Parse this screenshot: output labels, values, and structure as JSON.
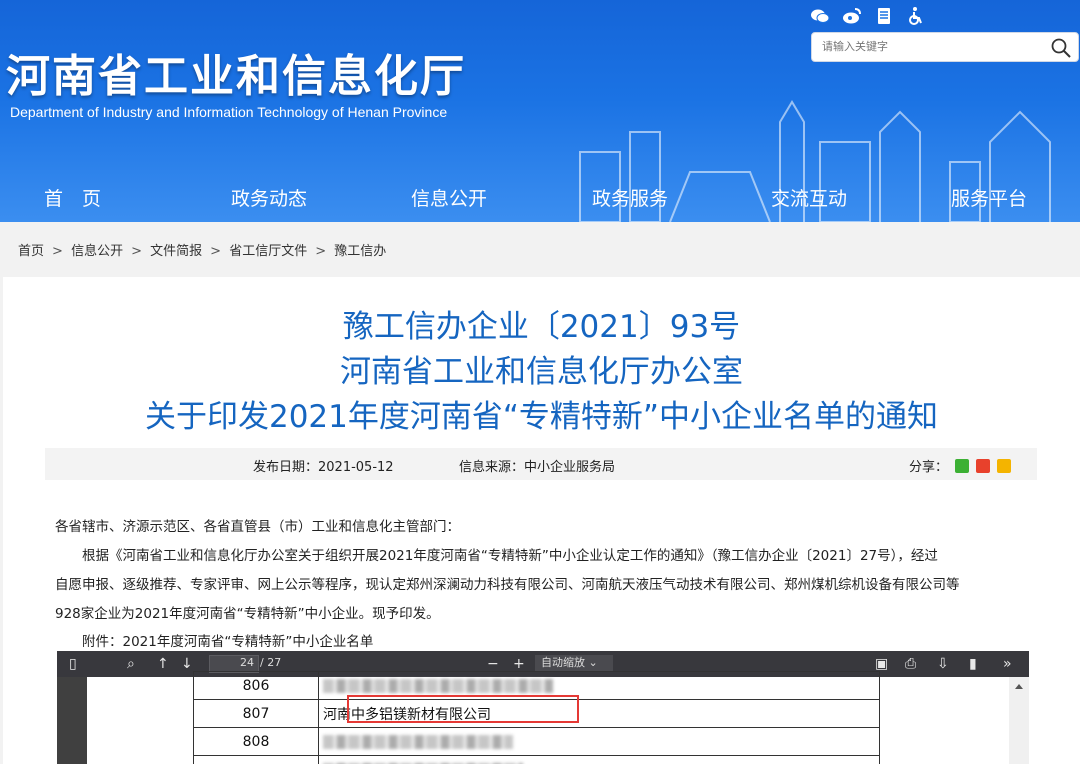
{
  "header": {
    "title": "河南省工业和信息化厅",
    "subtitle": "Department of Industry and Information Technology of Henan Province",
    "icons": [
      "wechat-icon",
      "weibo-icon",
      "document-icon",
      "accessibility-icon"
    ],
    "search": {
      "placeholder": "请输入关键字"
    },
    "nav": [
      "首　页",
      "政务动态",
      "信息公开",
      "政务服务",
      "交流互动",
      "服务平台"
    ]
  },
  "breadcrumb": [
    "首页",
    "信息公开",
    "文件简报",
    "省工信厅文件",
    "豫工信办"
  ],
  "breadcrumb_sep": ">",
  "article": {
    "title_lines": [
      "豫工信办企业〔2021〕93号",
      "河南省工业和信息化厅办公室",
      "关于印发2021年度河南省“专精特新”中小企业名单的通知"
    ],
    "date": "发布日期：2021-05-12",
    "source": "信息来源：中小企业服务局",
    "share_label": "分享：",
    "body": [
      "各省辖市、济源示范区、各省直管县（市）工业和信息化主管部门：",
      "　　根据《河南省工业和信息化厅办公室关于组织开展2021年度河南省“专精特新”中小企业认定工作的通知》（豫工信办企业〔2021〕27号），经过",
      "自愿申报、逐级推荐、专家评审、网上公示等程序，现认定郑州深澜动力科技有限公司、河南航天液压气动技术有限公司、郑州煤机综机设备有限公司等",
      "928家企业为2021年度河南省“专精特新”中小企业。现予印发。",
      "　　附件：2021年度河南省“专精特新”中小企业名单"
    ]
  },
  "pdf": {
    "page_current": "24",
    "page_total": "/ 27",
    "zoom": "自动缩放",
    "rows": [
      {
        "num": "806",
        "name": ""
      },
      {
        "num": "807",
        "name": "河南中多铝镁新材有限公司"
      },
      {
        "num": "808",
        "name": ""
      }
    ]
  },
  "colors": {
    "header_blue": "#1b73e4",
    "title_blue": "#1565c0",
    "highlight_red": "#e53935"
  }
}
